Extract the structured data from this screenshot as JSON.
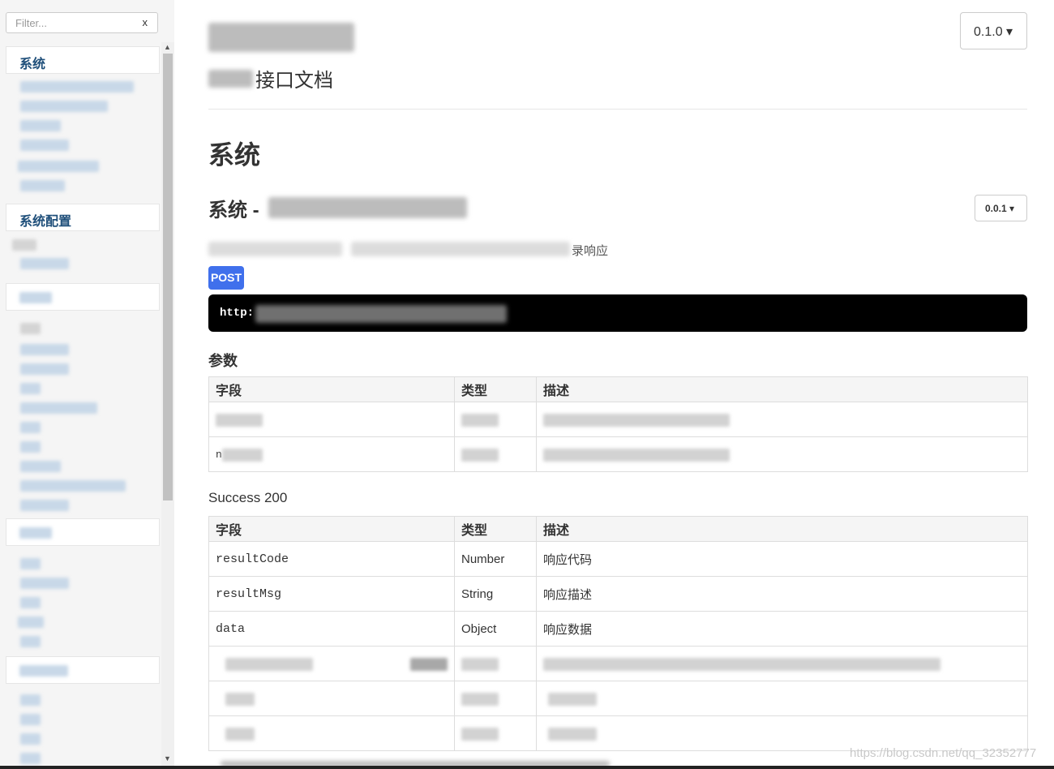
{
  "sidebar": {
    "filter": {
      "placeholder": "Filter...",
      "clear_label": "x"
    },
    "groups": [
      {
        "label": "系统"
      },
      {
        "label": "系统配置"
      }
    ],
    "scrollbar": {
      "up_arrow": "▲",
      "down_arrow": "▼"
    }
  },
  "header": {
    "subtitle": "接口文档",
    "version_label": "0.1.0",
    "caret": "▾"
  },
  "section": {
    "title": "系统",
    "api_title_prefix": "系统 -",
    "api_version_label": "0.0.1",
    "description_suffix": "录响应",
    "method": "POST",
    "url_prefix": "http:"
  },
  "params": {
    "heading": "参数",
    "columns": [
      "字段",
      "类型",
      "描述"
    ],
    "rows": [
      {
        "field_visible": "",
        "type": "",
        "desc": ""
      },
      {
        "field_visible": "n",
        "type": "",
        "desc": ""
      }
    ]
  },
  "success": {
    "heading": "Success 200",
    "columns": [
      "字段",
      "类型",
      "描述"
    ],
    "rows": [
      {
        "field": "resultCode",
        "type": "Number",
        "desc": "响应代码"
      },
      {
        "field": "resultMsg",
        "type": "String",
        "desc": "响应描述"
      },
      {
        "field": "data",
        "type": "Object",
        "desc": "响应数据"
      }
    ]
  },
  "watermark": "https://blog.csdn.net/qq_32352777"
}
